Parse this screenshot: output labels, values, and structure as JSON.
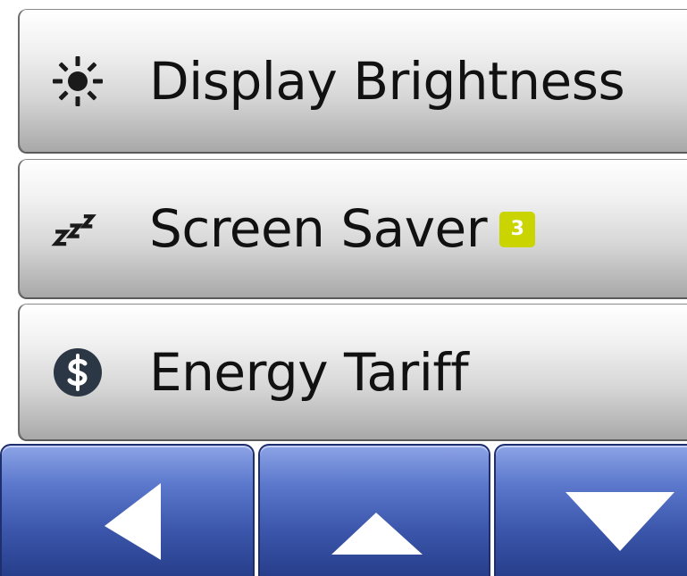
{
  "menu": {
    "items": [
      {
        "label": "Display Brightness",
        "icon": "sun-brightness-icon"
      },
      {
        "label": "Screen Saver",
        "icon": "zzz-sleep-icon",
        "badge": "3"
      },
      {
        "label": "Energy Tariff",
        "icon": "dollar-coin-icon"
      }
    ]
  },
  "nav": {
    "buttons": [
      {
        "name": "back",
        "icon": "arrow-left-icon"
      },
      {
        "name": "up",
        "icon": "arrow-up-icon"
      },
      {
        "name": "down",
        "icon": "arrow-down-icon"
      }
    ]
  },
  "colors": {
    "badge": "#c9d400",
    "nav_button": "#3b56ab",
    "coin": "#2b3744",
    "menu_gradient_bottom": "#a8a8a8"
  }
}
